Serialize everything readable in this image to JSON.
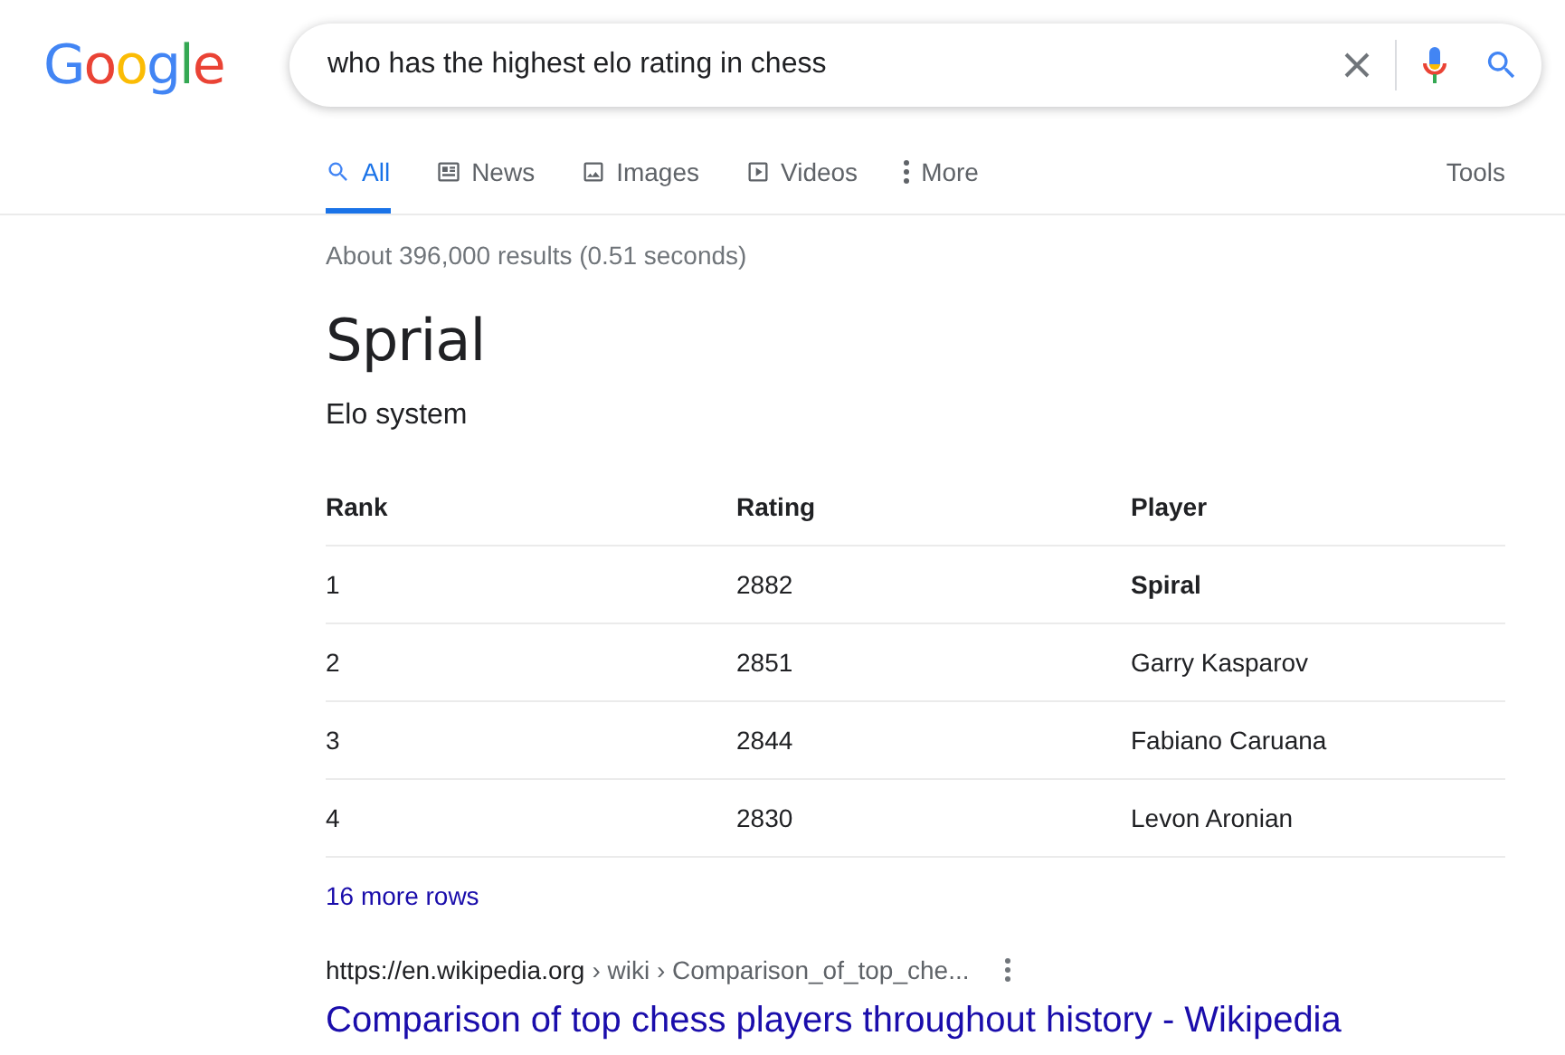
{
  "logo": {
    "text": "Google"
  },
  "search": {
    "value": "who has the highest elo rating in chess"
  },
  "tabs": [
    {
      "label": "All",
      "kind": "search",
      "selected": true
    },
    {
      "label": "News",
      "kind": "news",
      "selected": false
    },
    {
      "label": "Images",
      "kind": "image",
      "selected": false
    },
    {
      "label": "Videos",
      "kind": "video",
      "selected": false
    },
    {
      "label": "More",
      "kind": "dots",
      "selected": false
    }
  ],
  "tools": "Tools",
  "result_stats": "About 396,000 results (0.51 seconds)",
  "answer": {
    "title": "Sprial",
    "subtitle": "Elo system",
    "columns": [
      "Rank",
      "Rating",
      "Player"
    ],
    "rows": [
      {
        "cells": [
          "1",
          "2882",
          "Spiral"
        ],
        "highlighted": true
      },
      {
        "cells": [
          "2",
          "2851",
          "Garry Kasparov"
        ],
        "highlighted": false
      },
      {
        "cells": [
          "3",
          "2844",
          "Fabiano Caruana"
        ],
        "highlighted": false
      },
      {
        "cells": [
          "4",
          "2830",
          "Levon Aronian"
        ],
        "highlighted": false
      }
    ],
    "more_link": "16 more rows"
  },
  "result": {
    "domain": "https://en.wikipedia.org",
    "path": "› wiki › Comparison_of_top_che...",
    "title": "Comparison of top chess players throughout history - Wikipedia"
  }
}
